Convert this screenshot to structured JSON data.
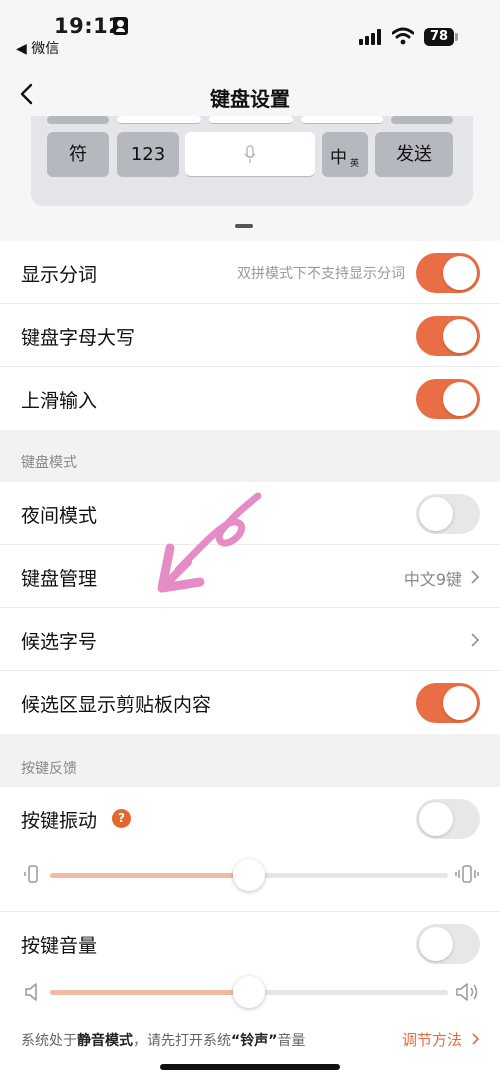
{
  "status_bar": {
    "time": "19:12",
    "back_app": "◀ 微信",
    "battery": "78"
  },
  "nav": {
    "title": "键盘设置",
    "back_icon": "chevron-left-icon"
  },
  "keyboard_preview": {
    "keys": [
      "符",
      "123",
      "中",
      "英",
      "发送"
    ],
    "space_icon": "microphone-icon"
  },
  "rows_general": [
    {
      "label": "显示分词",
      "hint": "双拼模式下不支持显示分词",
      "toggle": true
    },
    {
      "label": "键盘字母大写",
      "toggle": true
    },
    {
      "label": "上滑输入",
      "toggle": true
    }
  ],
  "section_mode": {
    "header": "键盘模式",
    "rows": [
      {
        "label": "夜间模式",
        "toggle": false
      },
      {
        "label": "键盘管理",
        "value": "中文9键"
      },
      {
        "label": "候选字号"
      },
      {
        "label": "候选区显示剪贴板内容",
        "toggle": true
      }
    ]
  },
  "section_feedback": {
    "header": "按键反馈",
    "vibration": {
      "label": "按键振动",
      "help": "?",
      "toggle": false,
      "level": 0.5
    },
    "volume": {
      "label": "按键音量",
      "toggle": false,
      "level": 0.5
    }
  },
  "footer": {
    "text_prefix": "系统处于",
    "text_bold1": "静音模式",
    "text_mid": "，请先打开系统",
    "text_bold2": "“铃声”",
    "text_suffix": "音量",
    "link": "调节方法"
  },
  "colors": {
    "accent": "#ea6e45",
    "toggle_off": "#e7e7ea",
    "annotation": "#e58bc6"
  }
}
